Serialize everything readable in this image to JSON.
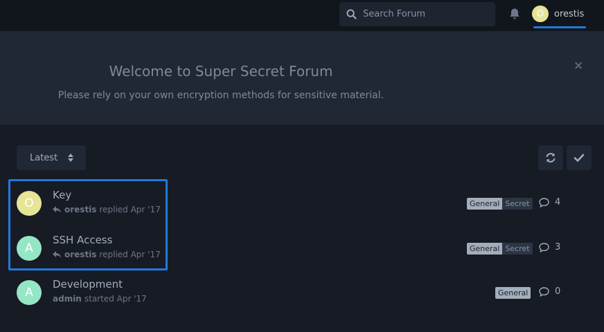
{
  "header": {
    "search_placeholder": "Search Forum",
    "user": {
      "initial": "O",
      "name": "orestis"
    }
  },
  "hero": {
    "title": "Welcome to Super Secret Forum",
    "subtitle": "Please rely on your own encryption methods for sensitive material.",
    "close_glyph": "×"
  },
  "toolbar": {
    "sort_label": "Latest"
  },
  "discussions": [
    {
      "initial": "O",
      "avatar_color": "#e6e495",
      "title": "Key",
      "author": "orestis",
      "action": "replied Apr '17",
      "reply_icon": true,
      "tags": [
        "General",
        "Secret"
      ],
      "reply_count": "4"
    },
    {
      "initial": "A",
      "avatar_color": "#95e6c5",
      "title": "SSH Access",
      "author": "orestis",
      "action": "replied Apr '17",
      "reply_icon": true,
      "tags": [
        "General",
        "Secret"
      ],
      "reply_count": "3"
    },
    {
      "initial": "A",
      "avatar_color": "#95e6c5",
      "title": "Development",
      "author": "admin",
      "action": "started Apr '17",
      "reply_icon": false,
      "tags": [
        "General"
      ],
      "reply_count": "0"
    }
  ],
  "colors": {
    "accent": "#1f7ae0",
    "background": "#161b24",
    "hero": "#202836"
  }
}
